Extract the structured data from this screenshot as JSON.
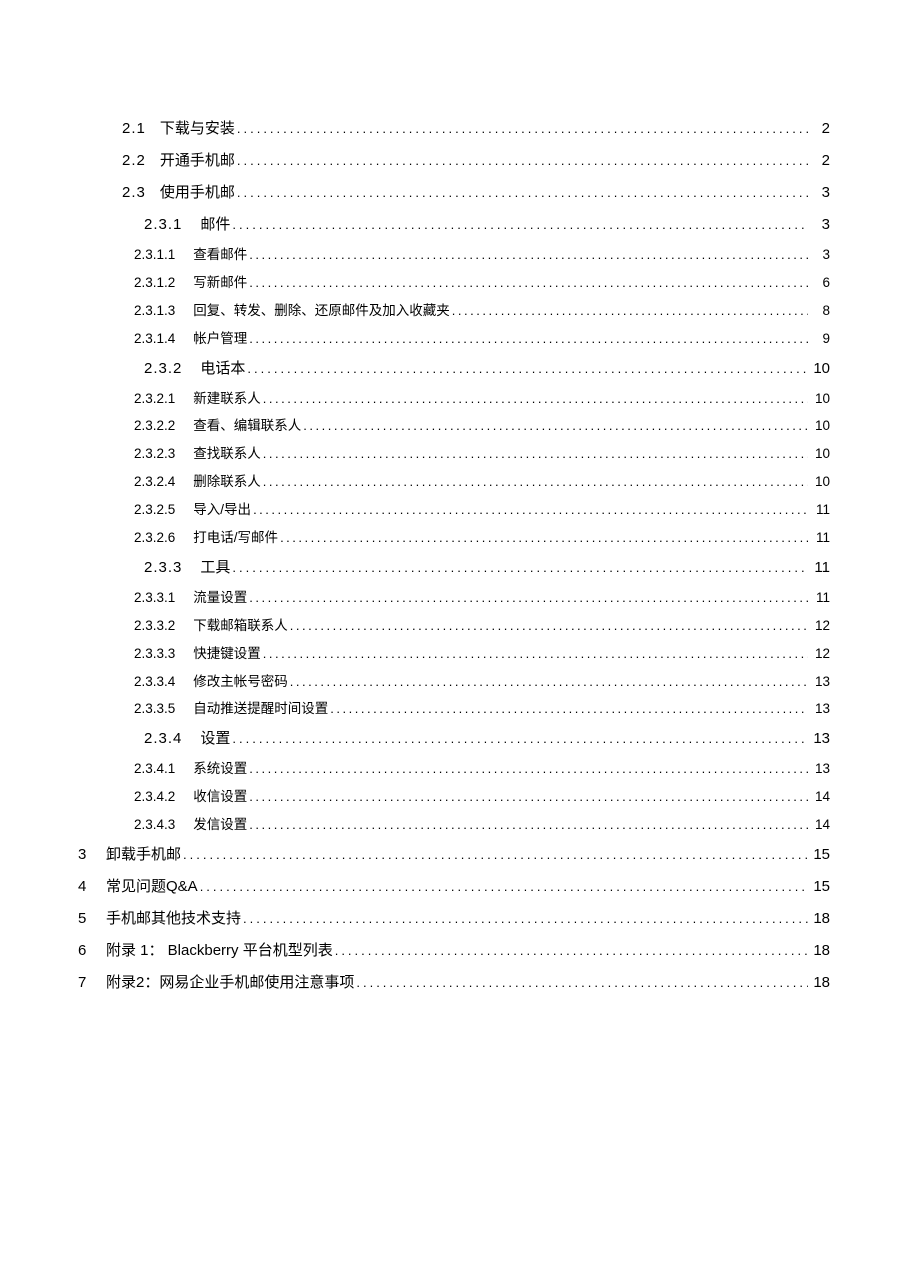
{
  "toc": [
    {
      "level": 2,
      "num": "2.1",
      "title": "下载与安装",
      "page": "2"
    },
    {
      "level": 2,
      "num": "2.2",
      "title": "开通手机邮",
      "page": "2"
    },
    {
      "level": 2,
      "num": "2.3",
      "title": "使用手机邮 ",
      "page": "3"
    },
    {
      "level": 3,
      "num": "2.3.1",
      "title": "邮件",
      "page": "3"
    },
    {
      "level": 4,
      "num": "2.3.1.1",
      "title": "查看邮件",
      "page": "3"
    },
    {
      "level": 4,
      "num": "2.3.1.2",
      "title": "写新邮件",
      "page": " 6"
    },
    {
      "level": 4,
      "num": "2.3.1.3",
      "title": "回复、转发、删除、还原邮件及加入收藏夹",
      "page": "8"
    },
    {
      "level": 4,
      "num": "2.3.1.4",
      "title": "帐户管理",
      "page": " 9"
    },
    {
      "level": 3,
      "num": "2.3.2",
      "title": "电话本",
      "page": "10"
    },
    {
      "level": 4,
      "num": "2.3.2.1",
      "title": "新建联系人",
      "page": "10"
    },
    {
      "level": 4,
      "num": "2.3.2.2",
      "title": "查看、编辑联系人",
      "page": "10"
    },
    {
      "level": 4,
      "num": "2.3.2.3",
      "title": "查找联系人",
      "page": "10"
    },
    {
      "level": 4,
      "num": "2.3.2.4",
      "title": "删除联系人",
      "page": " 10"
    },
    {
      "level": 4,
      "num": "2.3.2.5",
      "title": "导入/导出",
      "page": " 11"
    },
    {
      "level": 4,
      "num": "2.3.2.6",
      "title": "打电话/写邮件 ",
      "page": " 11"
    },
    {
      "level": 3,
      "num": "2.3.3",
      "title": "工具",
      "page": "11"
    },
    {
      "level": 4,
      "num": "2.3.3.1",
      "title": "流量设置",
      "page": "11"
    },
    {
      "level": 4,
      "num": "2.3.3.2",
      "title": "下载邮箱联系人",
      "page": "12"
    },
    {
      "level": 4,
      "num": "2.3.3.3",
      "title": "快捷键设置",
      "page": "12"
    },
    {
      "level": 4,
      "num": "2.3.3.4",
      "title": "修改主帐号密码",
      "page": "13"
    },
    {
      "level": 4,
      "num": "2.3.3.5",
      "title": "自动推送提醒时间设置",
      "page": "13"
    },
    {
      "level": 3,
      "num": "2.3.4",
      "title": "设置",
      "page": "13"
    },
    {
      "level": 4,
      "num": "2.3.4.1",
      "title": "系统设置",
      "page": " 13"
    },
    {
      "level": 4,
      "num": "2.3.4.2",
      "title": "收信设置",
      "page": "14"
    },
    {
      "level": 4,
      "num": "2.3.4.3",
      "title": "发信设置",
      "page": "14"
    },
    {
      "level": 1,
      "num": "3",
      "title": "卸载手机邮",
      "page": "15"
    },
    {
      "level": 1,
      "num": "4",
      "title": "常见问题Q&A",
      "page": "15"
    },
    {
      "level": 1,
      "num": "5",
      "title": "手机邮其他技术支持",
      "page": "18"
    },
    {
      "level": 1,
      "num": "6",
      "title": "附录 1： Blackberry 平台机型列表",
      "page": "18"
    },
    {
      "level": 1,
      "num": "7",
      "title": "附录2：网易企业手机邮使用注意事项",
      "page": "18"
    }
  ]
}
